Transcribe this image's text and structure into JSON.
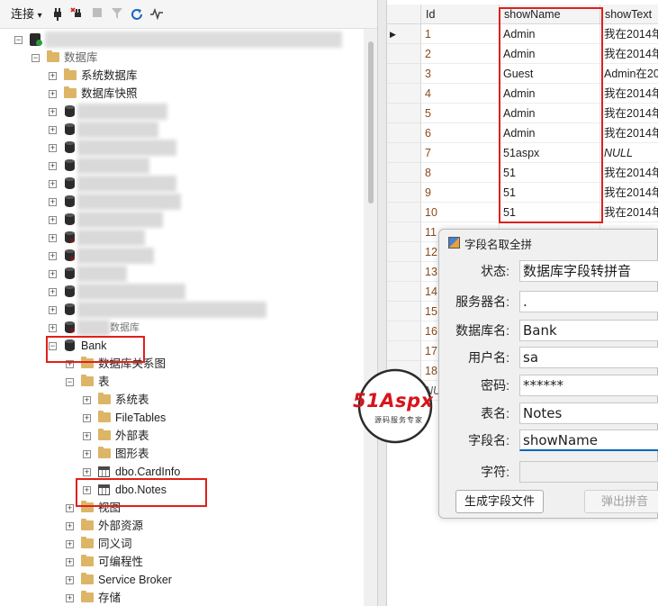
{
  "toolbar": {
    "connect_label": "连接",
    "connect_arrow": "▾",
    "icons": [
      "connect-plug-icon",
      "disconnect-plug-icon",
      "stop-icon",
      "filter-icon",
      "refresh-icon",
      "activity-monitor-icon"
    ]
  },
  "tree": {
    "databases_label": "数据库",
    "system_databases": "系统数据库",
    "snapshots": "数据库快照",
    "partial_label": "数据库",
    "bank": {
      "name": "Bank",
      "diagrams": "数据库关系图",
      "tables": "表",
      "table_children": [
        "系统表",
        "FileTables",
        "外部表",
        "图形表"
      ],
      "cardinfo": "dbo.CardInfo",
      "notes": "dbo.Notes",
      "after": [
        "视图",
        "外部资源",
        "同义词",
        "可编程性",
        "Service Broker",
        "存储"
      ]
    }
  },
  "grid": {
    "columns": [
      "Id",
      "showName",
      "showText"
    ],
    "rows": [
      {
        "id": "1",
        "name": "Admin",
        "text": "我在2014年"
      },
      {
        "id": "2",
        "name": "Admin",
        "text": "我在2014年"
      },
      {
        "id": "3",
        "name": "Guest",
        "text": "Admin在20"
      },
      {
        "id": "4",
        "name": "Admin",
        "text": "我在2014年"
      },
      {
        "id": "5",
        "name": "Admin",
        "text": "我在2014年"
      },
      {
        "id": "6",
        "name": "Admin",
        "text": "我在2014年"
      },
      {
        "id": "7",
        "name": "51aspx",
        "text": "NULL"
      },
      {
        "id": "8",
        "name": "51",
        "text": "我在2014年"
      },
      {
        "id": "9",
        "name": "51",
        "text": "我在2014年"
      },
      {
        "id": "10",
        "name": "51",
        "text": "我在2014年"
      },
      {
        "id": "11",
        "name": "",
        "text": ""
      },
      {
        "id": "12",
        "name": "",
        "text": ""
      },
      {
        "id": "13",
        "name": "",
        "text": ""
      },
      {
        "id": "14",
        "name": "",
        "text": ""
      },
      {
        "id": "15",
        "name": "",
        "text": ""
      },
      {
        "id": "16",
        "name": "",
        "text": ""
      },
      {
        "id": "17",
        "name": "",
        "text": ""
      },
      {
        "id": "18",
        "name": "",
        "text": ""
      },
      {
        "id": "NU",
        "name": "",
        "text": ""
      }
    ],
    "current_row_marker": "▶"
  },
  "dialog": {
    "title": "字段名取全拼",
    "labels": {
      "status": "状态:",
      "server": "服务器名:",
      "database": "数据库名:",
      "user": "用户名:",
      "password": "密码:",
      "table": "表名:",
      "field": "字段名:",
      "char": "字符:"
    },
    "values": {
      "status": "数据库字段转拼音",
      "server": ".",
      "database": "Bank",
      "user": "sa",
      "password": "******",
      "table": "Notes",
      "field": "showName",
      "char": ""
    },
    "buttons": {
      "generate": "生成字段文件",
      "popup": "弹出拼音"
    }
  },
  "logo": {
    "main": "51Aspx",
    "sub": "源码服务专家"
  },
  "colors": {
    "highlight_red": "#e0201c",
    "logo_red": "#d8141c",
    "id_brown": "#8a4a1a",
    "focus_blue": "#0067c0"
  }
}
